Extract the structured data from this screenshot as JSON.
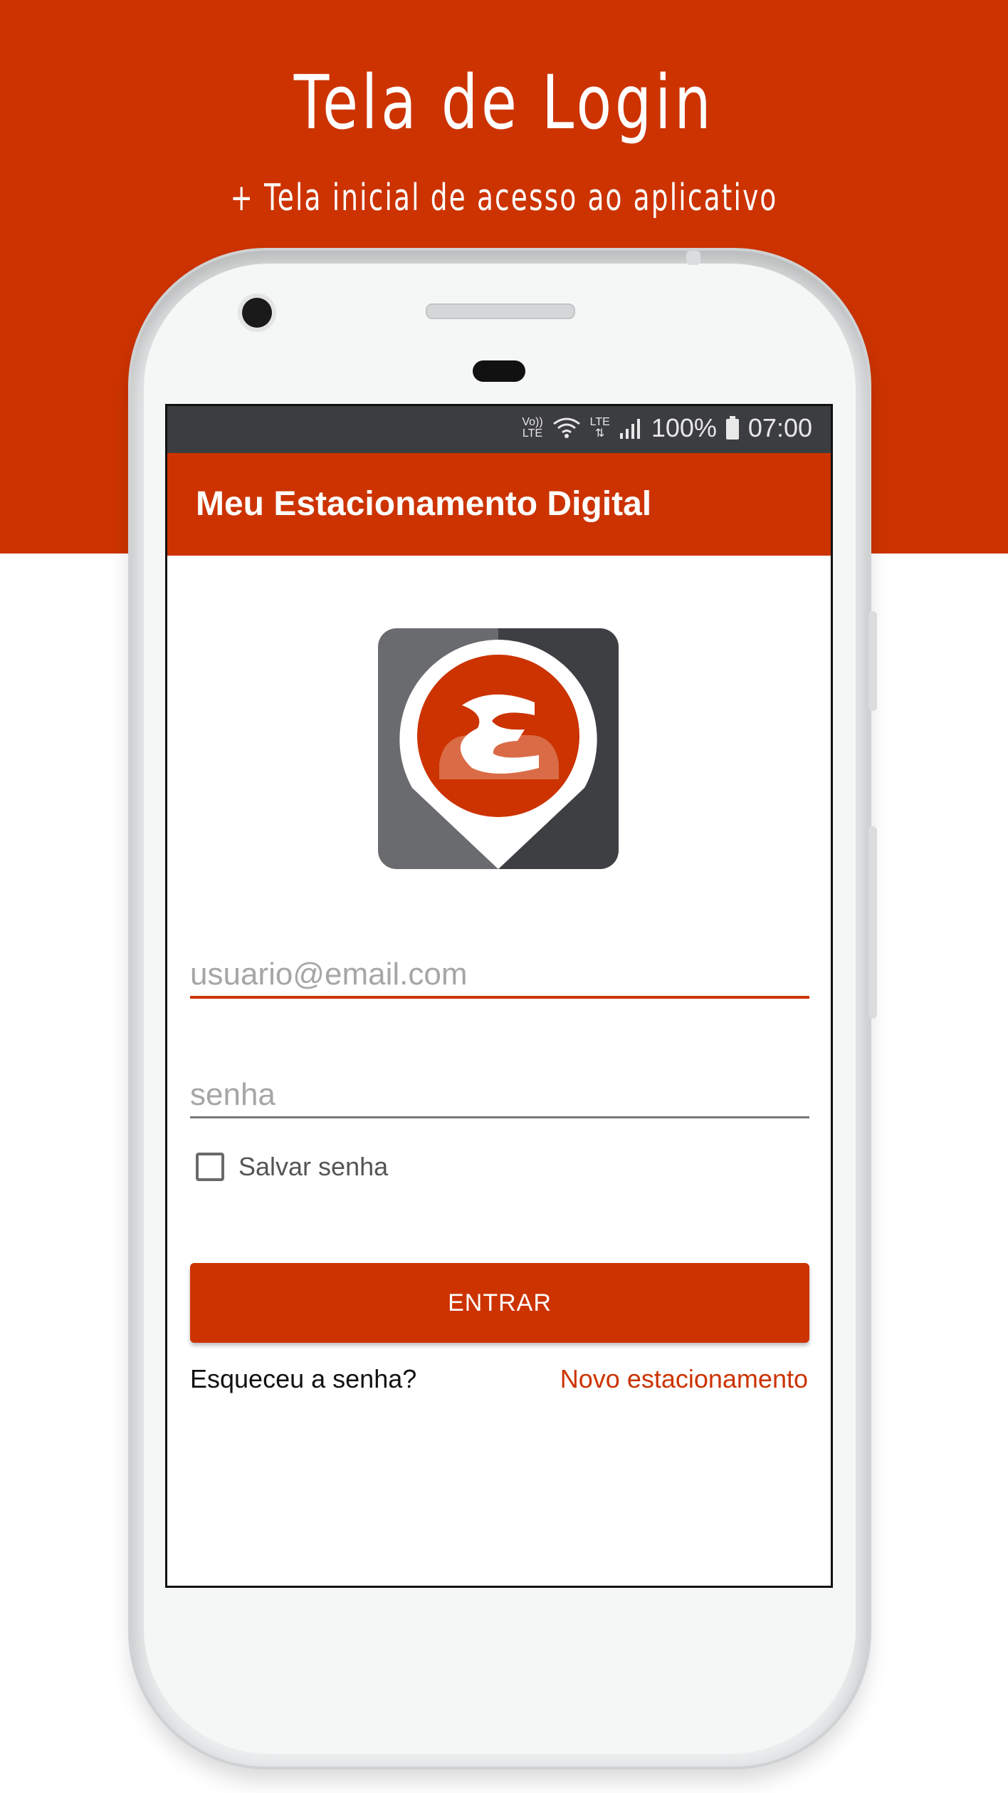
{
  "banner": {
    "title": "Tela de Login",
    "subtitle": "+ Tela inicial de acesso ao aplicativo"
  },
  "status_bar": {
    "volte_top": "Vo))",
    "volte_bottom": "LTE",
    "lte": "LTE",
    "battery": "100%",
    "time": "07:00",
    "icons": [
      "volte-icon",
      "wifi-icon",
      "lte-icon",
      "signal-icon",
      "battery-icon"
    ]
  },
  "app_bar": {
    "title": "Meu Estacionamento Digital"
  },
  "login": {
    "email_placeholder": "usuario@email.com",
    "password_placeholder": "senha",
    "save_password_label": "Salvar senha",
    "save_password_checked": false,
    "enter_button": "ENTRAR",
    "forgot_password": "Esqueceu a senha?",
    "new_parking": "Novo estacionamento"
  },
  "colors": {
    "brand": "#cc3300",
    "status_bar": "#3c3d40",
    "logo_dark": "#3e3f43",
    "logo_light": "#6a6b6e"
  }
}
